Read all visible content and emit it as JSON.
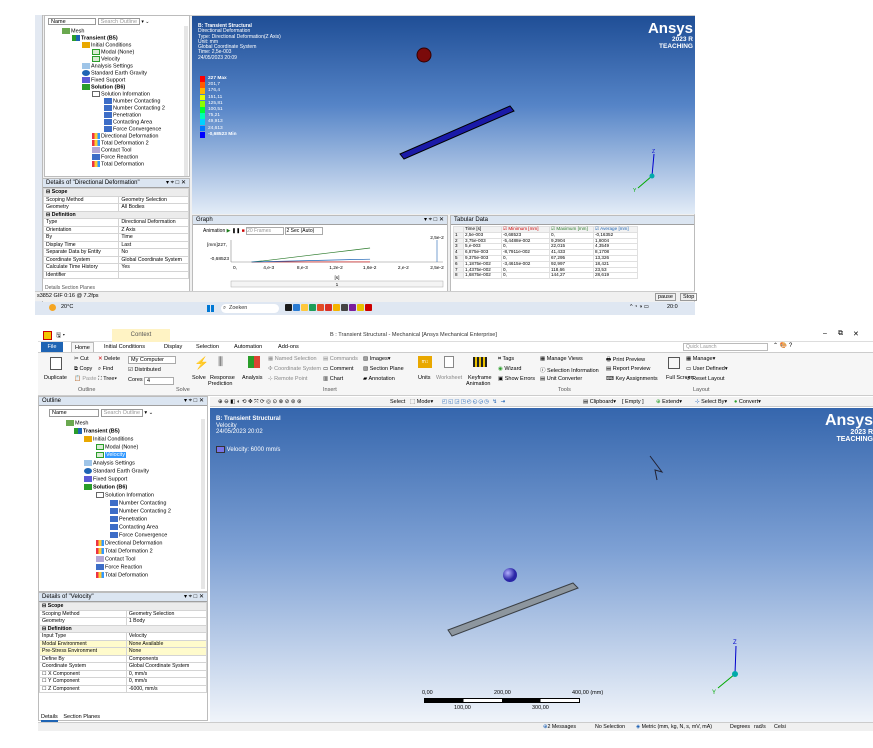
{
  "top": {
    "toolbar_name_label": "Name",
    "search_placeholder": "Search Outline",
    "tree": [
      {
        "label": "Mesh",
        "x": 62,
        "y": 28,
        "bold": false,
        "icon": "mesh-icon"
      },
      {
        "label": "Transient (B5)",
        "x": 72,
        "y": 35,
        "bold": true,
        "icon": "transient-icon"
      },
      {
        "label": "Initial Conditions",
        "x": 82,
        "y": 42,
        "bold": false,
        "icon": "folder-icon"
      },
      {
        "label": "Modal (None)",
        "x": 92,
        "y": 49,
        "bold": false,
        "icon": "check-icon"
      },
      {
        "label": "Velocity",
        "x": 92,
        "y": 56,
        "bold": false,
        "icon": "check-icon"
      },
      {
        "label": "Analysis Settings",
        "x": 82,
        "y": 63,
        "bold": false,
        "icon": "settings-icon"
      },
      {
        "label": "Standard Earth Gravity",
        "x": 82,
        "y": 70,
        "bold": false,
        "icon": "gravity-icon"
      },
      {
        "label": "Fixed Support",
        "x": 82,
        "y": 77,
        "bold": false,
        "icon": "support-icon"
      },
      {
        "label": "Solution (B6)",
        "x": 82,
        "y": 84,
        "bold": true,
        "icon": "solution-icon"
      },
      {
        "label": "Solution Information",
        "x": 92,
        "y": 91,
        "bold": false,
        "icon": "info-icon"
      },
      {
        "label": "Number Contacting",
        "x": 104,
        "y": 98,
        "bold": false,
        "icon": "probe-icon"
      },
      {
        "label": "Number Contacting 2",
        "x": 104,
        "y": 105,
        "bold": false,
        "icon": "probe-icon"
      },
      {
        "label": "Penetration",
        "x": 104,
        "y": 112,
        "bold": false,
        "icon": "probe-icon"
      },
      {
        "label": "Contacting Area",
        "x": 104,
        "y": 119,
        "bold": false,
        "icon": "probe-icon"
      },
      {
        "label": "Force Convergence",
        "x": 104,
        "y": 126,
        "bold": false,
        "icon": "probe-icon"
      },
      {
        "label": "Directional Deformation",
        "x": 92,
        "y": 133,
        "bold": false,
        "icon": "result-icon"
      },
      {
        "label": "Total Deformation 2",
        "x": 92,
        "y": 140,
        "bold": false,
        "icon": "result-icon"
      },
      {
        "label": "Contact Tool",
        "x": 92,
        "y": 147,
        "bold": false,
        "icon": "tool-icon"
      },
      {
        "label": "Force Reaction",
        "x": 92,
        "y": 154,
        "bold": false,
        "icon": "probe-icon"
      },
      {
        "label": "Total Deformation",
        "x": 92,
        "y": 161,
        "bold": false,
        "icon": "result-icon"
      }
    ],
    "details_title": "Details of \"Directional Deformation\"",
    "details": [
      {
        "group": "Scope"
      },
      {
        "k": "Scoping Method",
        "v": "Geometry Selection"
      },
      {
        "k": "Geometry",
        "v": "All Bodies"
      },
      {
        "group": "Definition"
      },
      {
        "k": "Type",
        "v": "Directional Deformation"
      },
      {
        "k": "Orientation",
        "v": "Z Axis"
      },
      {
        "k": "By",
        "v": "Time"
      },
      {
        "k": "Display Time",
        "v": "Last"
      },
      {
        "k": "Separate Data by Entity",
        "v": "No"
      },
      {
        "k": "Coordinate System",
        "v": "Global Coordinate System"
      },
      {
        "k": "Calculate Time History",
        "v": "Yes"
      },
      {
        "k": "Identifier",
        "v": ""
      }
    ],
    "details_tabs": "Details   Section Planes",
    "viewport_info": [
      "B: Transient Structural",
      "Directional Deformation",
      "Type: Directional Deformation(Z Axis)",
      "Unit: mm",
      "Global Coordinate System",
      "Time: 2,5e-003",
      "24/05/2023 20:09"
    ],
    "legend": [
      {
        "label": "227 Max",
        "color": "#ff0000",
        "bold": true
      },
      {
        "label": "201,7",
        "color": "#ff5a00"
      },
      {
        "label": "176,4",
        "color": "#ffb400"
      },
      {
        "label": "151,11",
        "color": "#e6ff00"
      },
      {
        "label": "125,81",
        "color": "#8cff00"
      },
      {
        "label": "100,51",
        "color": "#00ff32"
      },
      {
        "label": "75,21",
        "color": "#00ffb4"
      },
      {
        "label": "49,913",
        "color": "#00d2ff"
      },
      {
        "label": "24,613",
        "color": "#0078ff"
      },
      {
        "label": "-0,68523 Min",
        "color": "#0000ff",
        "bold": true
      }
    ],
    "brand": "Ansys",
    "brand_year": "2023 R",
    "brand_sub": "TEACHING",
    "graph_title": "Graph",
    "graph_toolbar": {
      "animation": "Animation",
      "frames": "20 Frames",
      "sec": "2 Sec (Auto)"
    },
    "graph_axis": {
      "ylabel": "[mm]",
      "ytop": "227,",
      "ybottom": "-0,68523",
      "xticks": [
        "0,",
        "4,e-3",
        "8,e-3",
        "1,2e-2",
        "1,6e-2",
        "2,e-2",
        "2,5e-2"
      ],
      "xlabel": "[s]",
      "end_label": "2,5e-2",
      "slider_value": "1"
    },
    "tabular_title": "Tabular Data",
    "tabular_headers": [
      "",
      "Time [s]",
      "Minimum [mm]",
      "Maximum [mm]",
      "Average [mm]"
    ],
    "tabular_rows": [
      [
        "1",
        "2,5e-003",
        "-0,68523",
        "0,",
        "-0,16352"
      ],
      [
        "2",
        "3,75e-003",
        "-5,4488e-002",
        "9,2904",
        "1,8004"
      ],
      [
        "3",
        "5,e-003",
        "0,",
        "22,015",
        "4,3549"
      ],
      [
        "4",
        "6,875e-003",
        "-8,7911e-002",
        "41,433",
        "8,1708"
      ],
      [
        "5",
        "9,375e-003",
        "0,",
        "67,295",
        "13,326"
      ],
      [
        "6",
        "1,1875e-002",
        "-3,4615e-002",
        "92,997",
        "18,421"
      ],
      [
        "7",
        "1,4375e-002",
        "0,",
        "118,66",
        "23,53"
      ],
      [
        "8",
        "1,6875e-002",
        "0,",
        "144,27",
        "28,619"
      ]
    ],
    "status_left": "s3852 GIF 0:16 @ 7.2fps",
    "status_btns": [
      "pause",
      "Stop"
    ],
    "taskbar_weather": "20°C",
    "taskbar_search": "Zoeken",
    "taskbar_time": "20:0"
  },
  "bottom": {
    "title": "B : Transient Structural - Mechanical [Ansys Mechanical Enterprise]",
    "context_tab": "Context",
    "menu_tabs": [
      "File",
      "Home",
      "Initial Conditions",
      "Display",
      "Selection",
      "Automation",
      "Add-ons"
    ],
    "quick_launch": "Quick Launch",
    "ribbon": {
      "duplicate": "Duplicate",
      "cut": "Cut",
      "copy": "Copy",
      "paste": "Paste",
      "delete": "Delete",
      "find": "Find",
      "tree": "Tree",
      "outline_group": "Outline",
      "my_computer": "My Computer",
      "distributed": "Distributed",
      "cores_label": "Cores",
      "cores_value": "4",
      "solve": "Solve",
      "solve_group": "Solve",
      "response": "Response",
      "prediction": "Prediction",
      "analysis": "Analysis",
      "named_selection": "Named Selection",
      "coordinate_system": "Coordinate System",
      "remote_point": "Remote Point",
      "commands": "Commands",
      "comment": "Comment",
      "chart": "Chart",
      "images": "Images",
      "section_plane": "Section Plane",
      "annotation": "Annotation",
      "insert_group": "Insert",
      "units": "Units",
      "worksheet": "Worksheet",
      "keyframe": "Keyframe",
      "animation": "Animation",
      "tags": "Tags",
      "wizard": "Wizard",
      "show_errors": "Show Errors",
      "manage_views": "Manage Views",
      "selection_information": "Selection Information",
      "unit_converter": "Unit Converter",
      "print_preview": "Print Preview",
      "report_preview": "Report Preview",
      "key_assignments": "Key Assignments",
      "tools_group": "Tools",
      "full_screen": "Full Screen",
      "manage": "Manage",
      "user_defined": "User Defined",
      "reset_layout": "Reset Layout",
      "layout_group": "Layout"
    },
    "outline_title": "Outline",
    "toolbar_name_label": "Name",
    "search_placeholder": "Search Outline",
    "tree": [
      {
        "label": "Mesh",
        "x": 66,
        "y": 420,
        "bold": false,
        "icon": "mesh-icon"
      },
      {
        "label": "Transient (B5)",
        "x": 74,
        "y": 428,
        "bold": true,
        "icon": "transient-icon"
      },
      {
        "label": "Initial Conditions",
        "x": 84,
        "y": 436,
        "bold": false,
        "icon": "folder-icon"
      },
      {
        "label": "Modal (None)",
        "x": 96,
        "y": 444,
        "bold": false,
        "icon": "check-icon"
      },
      {
        "label": "Velocity",
        "x": 96,
        "y": 452,
        "bold": false,
        "icon": "check-icon",
        "selected": true
      },
      {
        "label": "Analysis Settings",
        "x": 84,
        "y": 460,
        "bold": false,
        "icon": "settings-icon"
      },
      {
        "label": "Standard Earth Gravity",
        "x": 84,
        "y": 468,
        "bold": false,
        "icon": "gravity-icon"
      },
      {
        "label": "Fixed Support",
        "x": 84,
        "y": 476,
        "bold": false,
        "icon": "support-icon"
      },
      {
        "label": "Solution (B6)",
        "x": 84,
        "y": 484,
        "bold": true,
        "icon": "solution-icon"
      },
      {
        "label": "Solution Information",
        "x": 96,
        "y": 492,
        "bold": false,
        "icon": "info-icon"
      },
      {
        "label": "Number Contacting",
        "x": 110,
        "y": 500,
        "bold": false,
        "icon": "probe-icon"
      },
      {
        "label": "Number Contacting 2",
        "x": 110,
        "y": 508,
        "bold": false,
        "icon": "probe-icon"
      },
      {
        "label": "Penetration",
        "x": 110,
        "y": 516,
        "bold": false,
        "icon": "probe-icon"
      },
      {
        "label": "Contacting Area",
        "x": 110,
        "y": 524,
        "bold": false,
        "icon": "probe-icon"
      },
      {
        "label": "Force Convergence",
        "x": 110,
        "y": 532,
        "bold": false,
        "icon": "probe-icon"
      },
      {
        "label": "Directional Deformation",
        "x": 96,
        "y": 540,
        "bold": false,
        "icon": "result-icon"
      },
      {
        "label": "Total Deformation 2",
        "x": 96,
        "y": 548,
        "bold": false,
        "icon": "result-icon"
      },
      {
        "label": "Contact Tool",
        "x": 96,
        "y": 556,
        "bold": false,
        "icon": "tool-icon"
      },
      {
        "label": "Force Reaction",
        "x": 96,
        "y": 564,
        "bold": false,
        "icon": "probe-icon"
      },
      {
        "label": "Total Deformation",
        "x": 96,
        "y": 572,
        "bold": false,
        "icon": "result-icon"
      }
    ],
    "details_title": "Details of \"Velocity\"",
    "details": [
      {
        "group": "Scope"
      },
      {
        "k": "Scoping Method",
        "v": "Geometry Selection"
      },
      {
        "k": "Geometry",
        "v": "1 Body"
      },
      {
        "group": "Definition"
      },
      {
        "k": "Input Type",
        "v": "Velocity"
      },
      {
        "k": "Modal Environment",
        "v": "None Available",
        "hl": true
      },
      {
        "k": "Pre-Stress Environment",
        "v": "None",
        "hl": true
      },
      {
        "k": "Define By",
        "v": "Components"
      },
      {
        "k": "Coordinate System",
        "v": "Global Coordinate System"
      },
      {
        "k": "X Component",
        "v": "0, mm/s",
        "cb": true
      },
      {
        "k": "Y Component",
        "v": "0, mm/s",
        "cb": true
      },
      {
        "k": "Z Component",
        "v": "-6000, mm/s",
        "cb": true
      }
    ],
    "details_tabs": [
      "Details",
      "Section Planes"
    ],
    "viewport_info": [
      "B: Transient Structural",
      "Velocity",
      "24/05/2023 20:02"
    ],
    "velocity_legend": "Velocity: 6000 mm/s",
    "graphics_toolbar": {
      "select": "Select",
      "mode": "Mode",
      "clipboard": "Clipboard",
      "empty": "[ Empty ]",
      "extend": "Extend",
      "select_by": "Select By",
      "convert": "Convert"
    },
    "scale": {
      "t0": "0,00",
      "t200": "200,00",
      "t400": "400,00 (mm)",
      "t100": "100,00",
      "t300": "300,00"
    },
    "status": {
      "messages": "2 Messages",
      "selection": "No Selection",
      "metric": "Metric (mm, kg, N, s, mV, mA)",
      "degrees": "Degrees",
      "rad": "rad/s",
      "cel": "Celsi"
    },
    "brand": "Ansys",
    "brand_year": "2023 R",
    "brand_sub": "TEACHING"
  },
  "colors": {
    "title_blue": "#1f3b70",
    "file_tab": "#1e64b4",
    "highlight_yellow": "#fffbcc",
    "selection_blue": "#3399ff"
  }
}
